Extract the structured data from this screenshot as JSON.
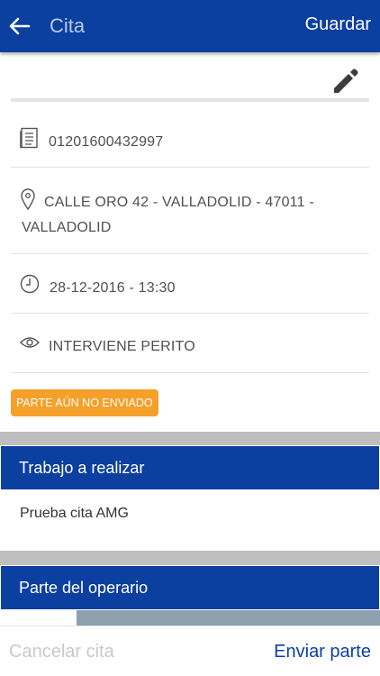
{
  "appbar": {
    "title": "Cita",
    "save_label": "Guardar",
    "back_icon": "arrow-left-icon"
  },
  "details": {
    "policy_number": "01201600432997",
    "address_line1": "CALLE ORO 42 - VALLADOLID - 47011 -",
    "address_line2": "VALLADOLID",
    "datetime": "28-12-2016 - 13:30",
    "visibility": "INTERVIENE PERITO"
  },
  "status_badge": "PARTE AÚN NO ENVIADO",
  "work_section": {
    "header": "Trabajo a realizar",
    "text": "Prueba cita AMG"
  },
  "operator_section": {
    "header": "Parte del operario"
  },
  "progress": {
    "fraction": 0.8
  },
  "footer": {
    "cancel_label": "Cancelar cita",
    "send_label": "Enviar parte"
  },
  "colors": {
    "primary": "#0b3fa0",
    "badge": "#f5a02a",
    "title_muted": "#b8cbea"
  }
}
